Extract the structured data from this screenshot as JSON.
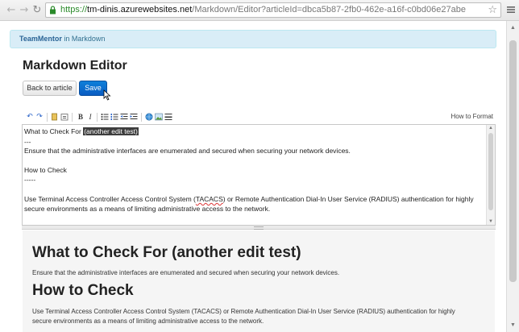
{
  "browser": {
    "url_scheme": "https://",
    "url_host": "tm-dinis.azurewebsites.net",
    "url_path": "/Markdown/Editor?articleId=dbca5b87-2fb0-462e-a16f-c0bd06e27abe",
    "icons": {
      "back": "arrow-left",
      "forward": "arrow-right",
      "reload": "reload",
      "secure": "lock",
      "bookmark": "star",
      "menu": "menu"
    }
  },
  "banner": {
    "brand": "TeamMentor",
    "section": " in Markdown"
  },
  "page": {
    "title": "Markdown Editor",
    "back_label": "Back to article",
    "save_label": "Save"
  },
  "toolbar": {
    "how_to_format": "How to Format",
    "tools": [
      "undo",
      "redo",
      "copy",
      "paste",
      "bold",
      "italic",
      "bullet-list",
      "numbered-list",
      "outdent",
      "indent",
      "link",
      "image",
      "horizontal-rule"
    ],
    "bold_glyph": "B",
    "italic_glyph": "I"
  },
  "editor": {
    "line1_prefix": "What to Check For ",
    "line1_selected": "(another edit test)",
    "line2": "---",
    "line3": "Ensure that the administrative interfaces are enumerated and secured when securing your network devices.",
    "line4": "How to Check",
    "line5": "-----",
    "line6_a": "Use Terminal Access Controller Access Control System (",
    "line6_b": "TACACS",
    "line6_c": ") or Remote Authentication Dial-In User Service (RADIUS) authentication for highly",
    "line7": "secure environments as a means of limiting administrative access to the network."
  },
  "preview": {
    "h1": "What to Check For (another edit test)",
    "p1": "Ensure that the administrative interfaces are enumerated and secured when securing your network devices.",
    "h2": "How to Check",
    "p2_line1": "Use Terminal Access Controller Access Control System (TACACS) or Remote Authentication Dial-In User Service (RADIUS) authentication for highly",
    "p2_line2": "secure environments as a means of limiting administrative access to the network."
  },
  "colors": {
    "save": "#0a5cc2",
    "banner_bg": "#d9edf7",
    "link": "#2a6496",
    "secure": "#2a8a2a"
  }
}
